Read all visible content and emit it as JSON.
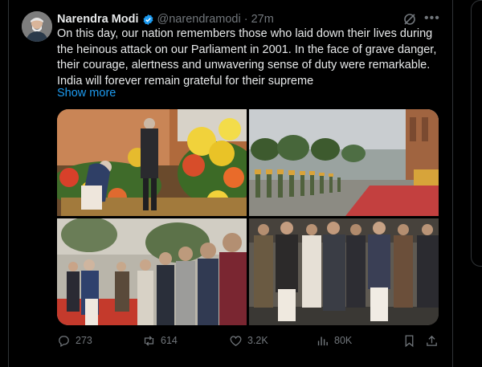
{
  "tweet": {
    "author_name": "Narendra Modi",
    "handle": "@narendramodi",
    "separator": "·",
    "time": "27m",
    "body_lines": [
      "On this day, our nation remembers those who laid down their lives during",
      "the heinous attack on our Parliament in 2001. In the face of grave danger,",
      "their courage, alertness and unwavering sense of duty were remarkable.",
      "India will forever remain grateful for their supreme"
    ],
    "show_more": "Show more"
  },
  "actions": {
    "replies": "273",
    "reposts": "614",
    "likes": "3.2K",
    "views": "80K"
  },
  "icons": {
    "verified": "verified-badge-icon",
    "grok": "grok-icon",
    "more": "more-icon",
    "reply": "reply-icon",
    "repost": "repost-icon",
    "like": "heart-icon",
    "views": "views-icon",
    "bookmark": "bookmark-icon",
    "share": "share-icon"
  },
  "colors": {
    "background": "#000000",
    "text": "#e7e9ea",
    "muted": "#71767b",
    "link": "#1d9bf0",
    "verified": "#1d9bf0",
    "border": "#2f3336"
  }
}
